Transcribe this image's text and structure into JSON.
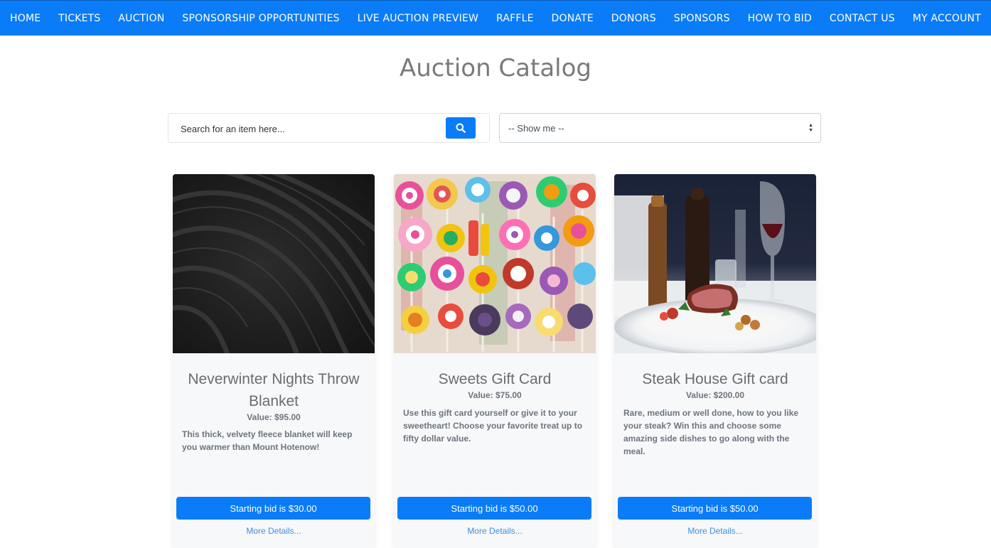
{
  "nav": {
    "items": [
      "HOME",
      "TICKETS",
      "AUCTION",
      "SPONSORSHIP OPPORTUNITIES",
      "LIVE AUCTION PREVIEW",
      "RAFFLE",
      "DONATE",
      "DONORS",
      "SPONSORS",
      "HOW TO BID",
      "CONTACT US",
      "MY ACCOUNT"
    ]
  },
  "page": {
    "title": "Auction Catalog"
  },
  "search": {
    "placeholder": "Search for an item here...",
    "value": "",
    "icon": "search-icon"
  },
  "filter": {
    "selected": "-- Show me --",
    "icon": "updown-chevrons-icon"
  },
  "colors": {
    "nav_bg": "#0a7cf8",
    "button_bg": "#0a7cf8",
    "link": "#3d8fe0"
  },
  "items": [
    {
      "title": "Neverwinter Nights Throw Blanket",
      "value": "Value: $95.00",
      "description": "This thick, velvety fleece blanket will keep you warmer than Mount Hotenow!",
      "bid_label": "Starting bid is $30.00",
      "details_label": "More Details..."
    },
    {
      "title": "Sweets Gift Card",
      "value": "Value: $75.00",
      "description": "Use this gift card yourself or give it to your sweetheart! Choose your favorite treat up to fifty dollar value.",
      "bid_label": "Starting bid is $50.00",
      "details_label": "More Details..."
    },
    {
      "title": "Steak House Gift card",
      "value": "Value: $200.00",
      "description": "Rare, medium or well done, how to you like your steak? Win this and choose some amazing side dishes to go along with the meal.",
      "bid_label": "Starting bid is $50.00",
      "details_label": "More Details..."
    }
  ]
}
